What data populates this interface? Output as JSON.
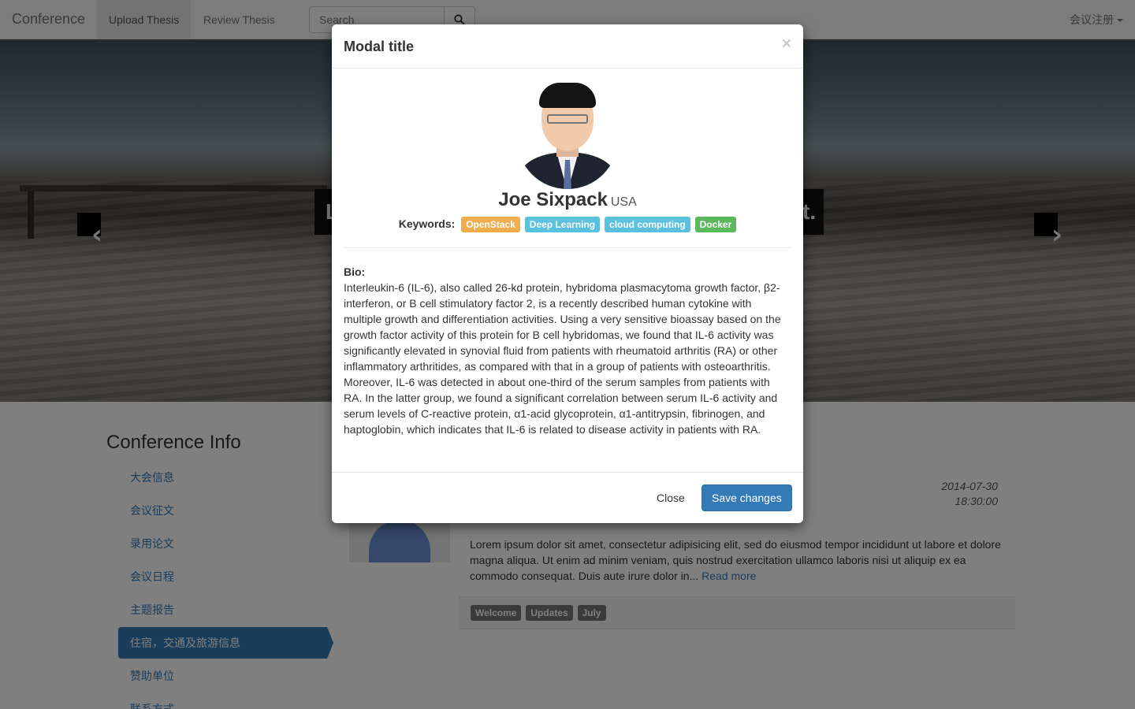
{
  "navbar": {
    "brand": "Conference",
    "items": [
      {
        "label": "Upload Thesis",
        "active": true
      },
      {
        "label": "Review Thesis",
        "active": false
      }
    ],
    "search_placeholder": "Search",
    "user_menu": "会议注册"
  },
  "carousel": {
    "caption_left": "L",
    "caption_right": "t."
  },
  "sidebar": {
    "title": "Conference Info",
    "items": [
      {
        "label": "大会信息"
      },
      {
        "label": "会议征文"
      },
      {
        "label": "录用论文"
      },
      {
        "label": "会议日程"
      },
      {
        "label": "主题报告"
      },
      {
        "label": "住宿，交通及旅游信息",
        "active": true
      },
      {
        "label": "赞助单位"
      },
      {
        "label": "联系方式"
      }
    ]
  },
  "post": {
    "date": "2014-07-30",
    "time": "18:30:00",
    "excerpt": "Lorem ipsum dolor sit amet, consectetur adipisicing elit, sed do eiusmod tempor incididunt ut labore et dolore magna aliqua. Ut enim ad minim veniam, quis nostrud exercitation ullamco laboris nisi ut aliquip ex ea commodo consequat. Duis aute irure dolor in...",
    "read_more": "Read more",
    "tags": [
      "Welcome",
      "Updates",
      "July"
    ]
  },
  "modal": {
    "title": "Modal title",
    "close_symbol": "×",
    "name": "Joe Sixpack",
    "country": "USA",
    "keywords_label": "Keywords:",
    "keywords": [
      {
        "text": "OpenStack",
        "color": "#f0ad4e"
      },
      {
        "text": "Deep Learning",
        "color": "#5bc0de"
      },
      {
        "text": "cloud computing",
        "color": "#5bc0de"
      },
      {
        "text": "Docker",
        "color": "#5cb85c"
      }
    ],
    "bio_label": "Bio:",
    "bio": "Interleukin-6 (IL-6), also called 26-kd protein, hybridoma plasmacytoma growth factor, β2-interferon, or B cell stimulatory factor 2, is a recently described human cytokine with multiple growth and differentiation activities. Using a very sensitive bioassay based on the growth factor activity of this protein for B cell hybridomas, we found that IL-6 activity was significantly elevated in synovial fluid from patients with rheumatoid arthritis (RA) or other inflammatory arthritides, as compared with that in a group of patients with osteoarthritis. Moreover, IL-6 was detected in about one-third of the serum samples from patients with RA. In the latter group, we found a significant correlation between serum IL-6 activity and serum levels of C-reactive protein, α1-acid glycoprotein, α1-antitrypsin, fibrinogen, and haptoglobin, which indicates that IL-6 is related to disease activity in patients with RA.",
    "close_button": "Close",
    "save_button": "Save changes"
  },
  "colors": {
    "primary": "#337ab7",
    "backdrop": "rgba(0,0,0,0.5)"
  }
}
